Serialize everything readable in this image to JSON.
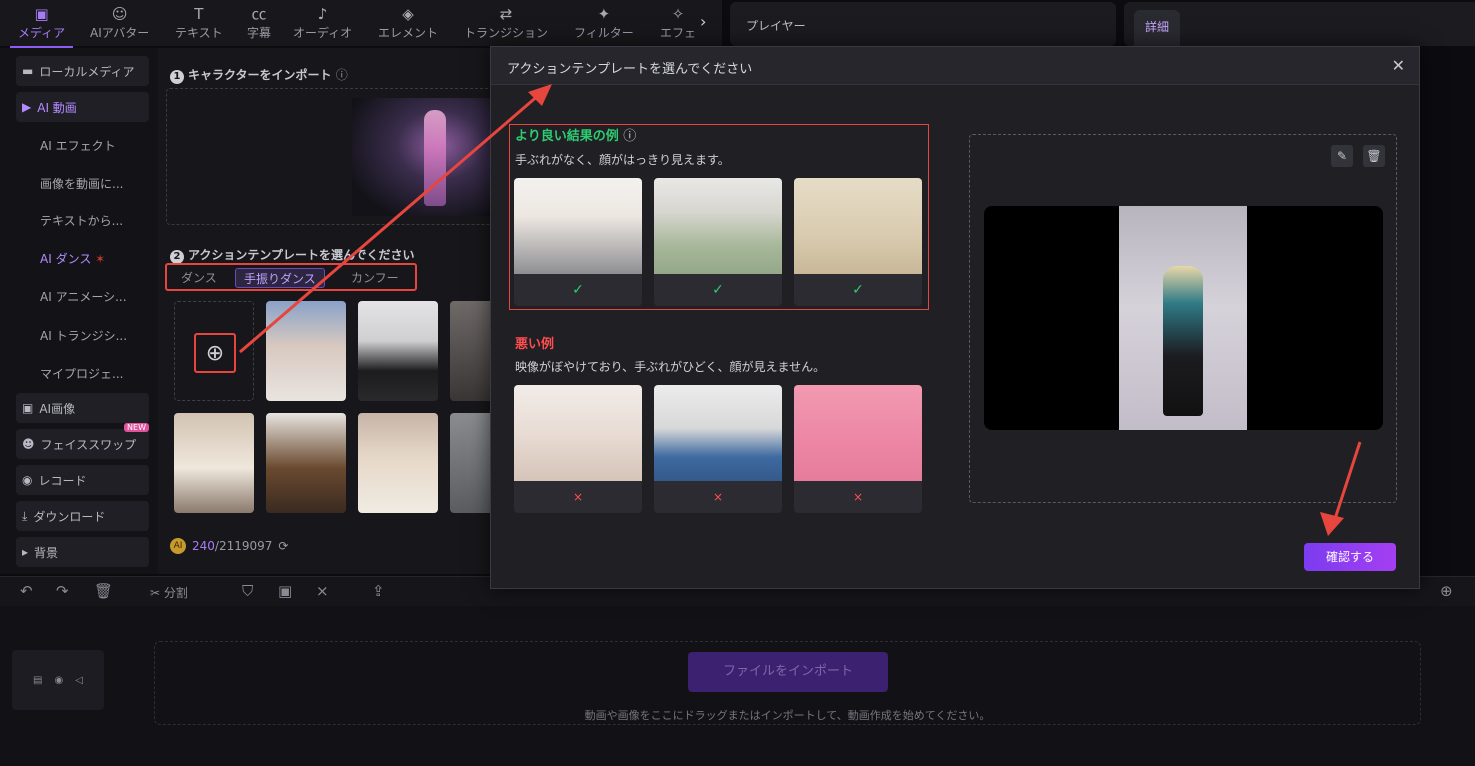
{
  "toolbar": {
    "tools": [
      {
        "label": "メディア",
        "icon": "media-icon"
      },
      {
        "label": "AIアバター",
        "icon": "avatar-icon"
      },
      {
        "label": "テキスト",
        "icon": "text-icon"
      },
      {
        "label": "字幕",
        "icon": "caption-icon"
      },
      {
        "label": "オーディオ",
        "icon": "music-icon"
      },
      {
        "label": "エレメント",
        "icon": "element-icon"
      },
      {
        "label": "トランジション",
        "icon": "transition-icon"
      },
      {
        "label": "フィルター",
        "icon": "filter-icon"
      },
      {
        "label": "エフェ",
        "icon": "effect-icon"
      }
    ],
    "active_index": 0
  },
  "player": {
    "title": "プレイヤー"
  },
  "details": {
    "tab": "詳細"
  },
  "sidebar": {
    "local_media": "ローカルメディア",
    "ai_video": "AI 動画",
    "sub_items": [
      "AI エフェクト",
      "画像を動画に...",
      "テキストから...",
      "AI ダンス",
      "AI アニメーシ...",
      "AI トランジシ...",
      "マイプロジェ..."
    ],
    "ai_image": "AI画像",
    "face_swap": "フェイススワップ",
    "face_swap_badge": "NEW",
    "record": "レコード",
    "download": "ダウンロード",
    "background": "背景"
  },
  "media_panel": {
    "step1": "キャラクターをインポート",
    "step2": "アクションテンプレートを選んでください",
    "tabs": [
      "ダンス",
      "手振りダンス",
      "カンフー"
    ],
    "active_tab": 1,
    "credits_used": "240",
    "credits_total": "/2119097"
  },
  "timeline": {
    "split_label": "分割",
    "import_button": "ファイルをインポート",
    "drop_hint": "動画や画像をここにドラッグまたはインポートして、動画作成を始めてください。"
  },
  "modal": {
    "title": "アクションテンプレートを選んでください",
    "good_title": "より良い結果の例",
    "good_desc": "手ぶれがなく、顔がはっきり見えます。",
    "bad_title": "悪い例",
    "bad_desc": "映像がぼやけており、手ぶれがひどく、顔が見えません。",
    "ok_mark": "✓",
    "ng_mark": "×",
    "confirm": "確認する"
  },
  "colors": {
    "accent": "#8b5cf6",
    "good": "#2ecc71",
    "bad": "#ff4d4f",
    "annotation": "#e6463e"
  }
}
